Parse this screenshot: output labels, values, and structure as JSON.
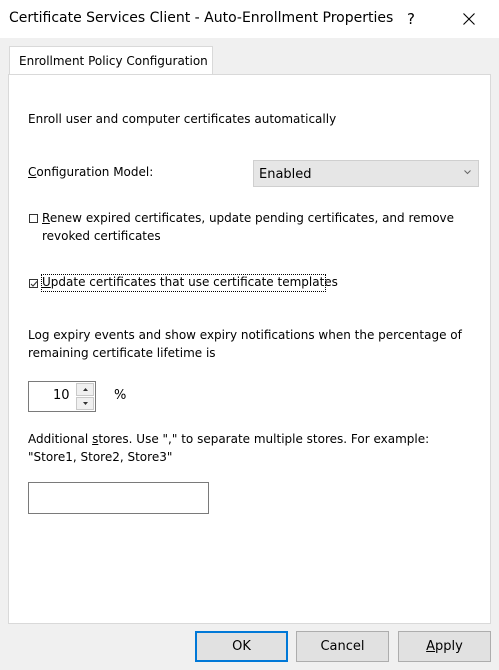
{
  "window": {
    "title": "Certificate Services Client - Auto-Enrollment Properties",
    "help_glyph": "?"
  },
  "tabs": [
    {
      "label": "Enrollment Policy Configuration"
    }
  ],
  "main": {
    "intro": "Enroll user and computer certificates automatically",
    "config_model": {
      "label_mnemonic": "C",
      "label_rest": "onfiguration Model:",
      "selected": "Enabled"
    },
    "renew_checkbox": {
      "checked": false,
      "mnemonic": "R",
      "label_rest": "enew expired certificates, update pending certificates, and remove revoked certificates"
    },
    "update_checkbox": {
      "checked": true,
      "mnemonic": "U",
      "label_rest": "pdate certificates that use certificate templates"
    },
    "expiry": {
      "description": "Log expiry events and show expiry notifications when the percentage of remaining certificate lifetime is",
      "value": "10",
      "unit": "%"
    },
    "stores": {
      "description_prefix": "Additional ",
      "mnemonic": "s",
      "description_rest": "tores. Use \",\" to separate multiple stores. For example: \"Store1, Store2, Store3\"",
      "value": ""
    }
  },
  "buttons": {
    "ok": "OK",
    "cancel": "Cancel",
    "apply_mnemonic": "A",
    "apply_rest": "pply"
  }
}
